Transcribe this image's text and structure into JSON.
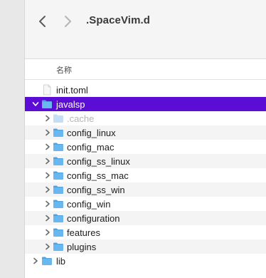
{
  "window": {
    "title": ".SpaceVim.d"
  },
  "columns": {
    "name": "名称"
  },
  "rows": [
    {
      "name": "init.toml",
      "kind": "file",
      "depth": 0,
      "expander": "none",
      "selected": false,
      "dim": false
    },
    {
      "name": "javalsp",
      "kind": "folder",
      "depth": 0,
      "expander": "expanded",
      "selected": true,
      "dim": false
    },
    {
      "name": ".cache",
      "kind": "folder",
      "depth": 1,
      "expander": "collapsed",
      "selected": false,
      "dim": true
    },
    {
      "name": "config_linux",
      "kind": "folder",
      "depth": 1,
      "expander": "collapsed",
      "selected": false,
      "dim": false
    },
    {
      "name": "config_mac",
      "kind": "folder",
      "depth": 1,
      "expander": "collapsed",
      "selected": false,
      "dim": false
    },
    {
      "name": "config_ss_linux",
      "kind": "folder",
      "depth": 1,
      "expander": "collapsed",
      "selected": false,
      "dim": false
    },
    {
      "name": "config_ss_mac",
      "kind": "folder",
      "depth": 1,
      "expander": "collapsed",
      "selected": false,
      "dim": false
    },
    {
      "name": "config_ss_win",
      "kind": "folder",
      "depth": 1,
      "expander": "collapsed",
      "selected": false,
      "dim": false
    },
    {
      "name": "config_win",
      "kind": "folder",
      "depth": 1,
      "expander": "collapsed",
      "selected": false,
      "dim": false
    },
    {
      "name": "configuration",
      "kind": "folder",
      "depth": 1,
      "expander": "collapsed",
      "selected": false,
      "dim": false
    },
    {
      "name": "features",
      "kind": "folder",
      "depth": 1,
      "expander": "collapsed",
      "selected": false,
      "dim": false
    },
    {
      "name": "plugins",
      "kind": "folder",
      "depth": 1,
      "expander": "collapsed",
      "selected": false,
      "dim": false
    },
    {
      "name": "lib",
      "kind": "folder",
      "depth": 0,
      "expander": "collapsed",
      "selected": false,
      "dim": false
    }
  ],
  "colors": {
    "selection": "#5b0dd5",
    "folder": "#69b7ef",
    "folder_tab": "#4fa3e3",
    "folder_dim": "#c4dff5",
    "stripe": "#f4f4f4"
  },
  "icons": {
    "back": "chevron-left-icon",
    "forward": "chevron-right-icon",
    "folder": "folder-icon",
    "file": "document-icon",
    "disclosure_collapsed": "disclosure-right-icon",
    "disclosure_expanded": "disclosure-down-icon"
  }
}
